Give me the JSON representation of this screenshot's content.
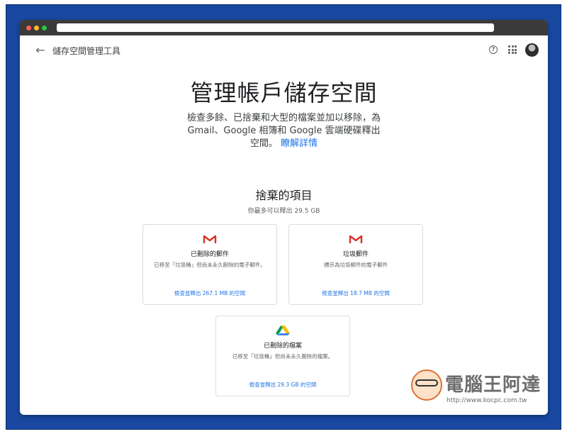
{
  "app": {
    "title": "儲存空間管理工具"
  },
  "hero": {
    "title": "管理帳戶儲存空間",
    "description": "檢查多餘、已捨棄和大型的檔案並加以移除，為 Gmail、Google 相簿和 Google 雲端硬碟釋出空間。",
    "link": "瞭解詳情"
  },
  "section": {
    "title": "捨棄的項目",
    "subtitle": "你最多可以釋出 29.5 GB"
  },
  "cards": [
    {
      "icon": "gmail-icon",
      "title": "已刪除的郵件",
      "description": "已移至「垃圾桶」但尚未永久刪除的電子郵件。",
      "action": "檢查並釋出 267.1 MB 的空間"
    },
    {
      "icon": "gmail-icon",
      "title": "垃圾郵件",
      "description": "標示為垃圾郵件的電子郵件",
      "action": "檢查並釋出 18.7 MB 的空間"
    },
    {
      "icon": "google-drive-icon",
      "title": "已刪除的檔案",
      "description": "已移至「垃圾桶」但尚未永久刪除的檔案。",
      "action": "檢查並釋出 29.3 GB 的空間"
    }
  ],
  "watermark": {
    "name": "電腦王阿達",
    "url": "http://www.kocpc.com.tw"
  },
  "colors": {
    "background_frame": "#1848a0",
    "link_blue": "#1a73e8",
    "gmail_red": "#d93025"
  }
}
